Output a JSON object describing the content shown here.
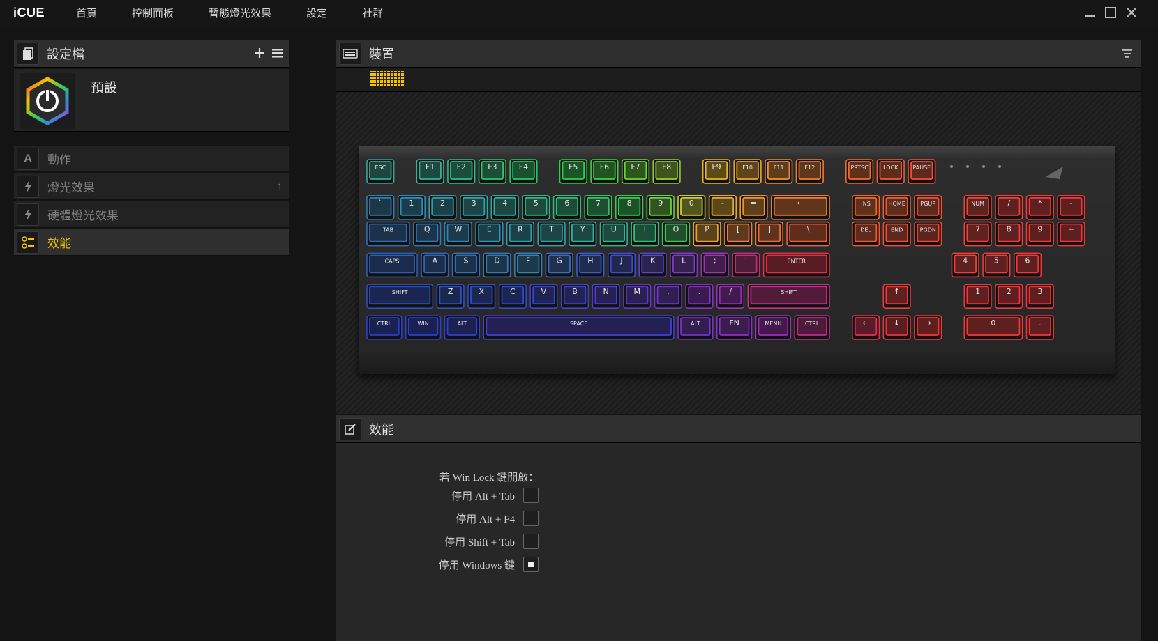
{
  "app": {
    "logo": "iCUE",
    "nav": [
      "首頁",
      "控制面板",
      "暫態燈光效果",
      "設定",
      "社群"
    ],
    "window_controls": [
      "minimize-icon",
      "maximize-icon",
      "close-icon"
    ]
  },
  "profiles": {
    "title": "設定檔",
    "icons": [
      "profiles-icon",
      "add-icon",
      "menu-icon"
    ],
    "current": {
      "name": "預設",
      "icon": "icue-power-logo"
    }
  },
  "menu": [
    {
      "label": "動作",
      "icon": "action-icon",
      "count": "",
      "active": false
    },
    {
      "label": "燈光效果",
      "icon": "lightning-icon",
      "count": "1",
      "active": false
    },
    {
      "label": "硬體燈光效果",
      "icon": "lightning-icon",
      "count": "",
      "active": false
    },
    {
      "label": "效能",
      "icon": "performance-icon",
      "count": "",
      "active": true
    }
  ],
  "device": {
    "title": "裝置",
    "icon": "keyboard-icon",
    "accent": "#f2c200"
  },
  "performance": {
    "title": "效能",
    "icon": "edit-icon",
    "win_lock_title": "若 Win Lock 鍵開啟：",
    "options": [
      {
        "label": "停用 Alt + Tab",
        "checked": false
      },
      {
        "label": "停用 Alt + F4",
        "checked": false
      },
      {
        "label": "停用 Shift + Tab",
        "checked": false
      },
      {
        "label": "停用 Windows 鍵",
        "checked": true
      }
    ]
  },
  "keyboard": {
    "rows": [
      [
        [
          "ESC",
          1,
          "#35a89a"
        ],
        [
          "gap",
          0.6
        ],
        [
          "F1",
          1,
          "#2fb59b"
        ],
        [
          "F2",
          1,
          "#2fbd8b"
        ],
        [
          "F3",
          1,
          "#2bc47a"
        ],
        [
          "F4",
          1,
          "#28c868"
        ],
        [
          "gap",
          0.6
        ],
        [
          "F5",
          1,
          "#2dd04c"
        ],
        [
          "F6",
          1,
          "#3bd43c"
        ],
        [
          "F7",
          1,
          "#68d43a"
        ],
        [
          "F8",
          1,
          "#96d030"
        ],
        [
          "gap",
          0.6
        ],
        [
          "F9",
          1,
          "#e8b820"
        ],
        [
          "F10",
          1,
          "#eda628"
        ],
        [
          "F11",
          1,
          "#ef922c"
        ],
        [
          "F12",
          1,
          "#f07e2e"
        ],
        [
          "gap",
          0.6
        ],
        [
          "PRTSC",
          1,
          "#f06a2e"
        ],
        [
          "LOCK",
          1,
          "#f05e30"
        ],
        [
          "PAUSE",
          1,
          "#f05232"
        ]
      ],
      [
        [
          "`",
          1,
          "#2e7fb0"
        ],
        [
          "1",
          1,
          "#2f8cb5"
        ],
        [
          "2",
          1,
          "#2f99b0"
        ],
        [
          "3",
          1,
          "#30a5a8"
        ],
        [
          "4",
          1,
          "#31ad9e"
        ],
        [
          "5",
          1,
          "#31b48f"
        ],
        [
          "6",
          1,
          "#30bc7d"
        ],
        [
          "7",
          1,
          "#2fc46a"
        ],
        [
          "8",
          1,
          "#34cc52"
        ],
        [
          "9",
          1,
          "#6ed03c"
        ],
        [
          "0",
          1,
          "#c8d030"
        ],
        [
          "-",
          1,
          "#e8ac28"
        ],
        [
          "=",
          1,
          "#ee9430"
        ],
        [
          "←",
          2,
          "#f07a2e"
        ],
        [
          "gap",
          0.6
        ],
        [
          "INS",
          1,
          "#f06a2e"
        ],
        [
          "HOME",
          1,
          "#f05e30"
        ],
        [
          "PGUP",
          1,
          "#f05232"
        ],
        [
          "gap",
          0.6
        ],
        [
          "NUM",
          1,
          "#f04438"
        ],
        [
          "/",
          1,
          "#f04038"
        ],
        [
          "*",
          1,
          "#f03c3a"
        ],
        [
          "-",
          1,
          "#f0383a"
        ]
      ],
      [
        [
          "TAB",
          1.5,
          "#2d6fb4"
        ],
        [
          "Q",
          1,
          "#2d7ab8"
        ],
        [
          "W",
          1,
          "#2e86b8"
        ],
        [
          "E",
          1,
          "#2f92b6"
        ],
        [
          "R",
          1,
          "#2f9cb2"
        ],
        [
          "T",
          1,
          "#30a6aa"
        ],
        [
          "Y",
          1,
          "#31b09e"
        ],
        [
          "U",
          1,
          "#31b690"
        ],
        [
          "I",
          1,
          "#30be7c"
        ],
        [
          "O",
          1,
          "#40c45e"
        ],
        [
          "P",
          1,
          "#e89e2c"
        ],
        [
          "[",
          1,
          "#ef842e"
        ],
        [
          "]",
          1,
          "#f07230"
        ],
        [
          "\\",
          1.5,
          "#f06232"
        ],
        [
          "gap",
          0.6
        ],
        [
          "DEL",
          1,
          "#f05a32"
        ],
        [
          "END",
          1,
          "#f05034"
        ],
        [
          "PGDN",
          1,
          "#f04834"
        ],
        [
          "gap",
          0.6
        ],
        [
          "7",
          1,
          "#f04238"
        ],
        [
          "8",
          1,
          "#f03e3a"
        ],
        [
          "9",
          1,
          "#f03a3a"
        ],
        [
          "+",
          1,
          "#f0363c"
        ]
      ],
      [
        [
          "CAPS",
          1.75,
          "#2d5cb8"
        ],
        [
          "A",
          1,
          "#2d66ba"
        ],
        [
          "S",
          1,
          "#2e70ba"
        ],
        [
          "D",
          1,
          "#2e7ab8"
        ],
        [
          "F",
          1,
          "#2f84b8"
        ],
        [
          "G",
          1,
          "#3a6cc0"
        ],
        [
          "H",
          1,
          "#3a5cc8"
        ],
        [
          "J",
          1,
          "#3e4ccc"
        ],
        [
          "K",
          1,
          "#5a44c8"
        ],
        [
          "L",
          1,
          "#7c3cc4"
        ],
        [
          ";",
          1,
          "#9c34b8"
        ],
        [
          "'",
          1,
          "#c0307a"
        ],
        [
          "ENTER",
          2.25,
          "#e03046"
        ],
        [
          "gap",
          3.8
        ],
        [
          "4",
          1,
          "#f04038"
        ],
        [
          "5",
          1,
          "#f03c3a"
        ],
        [
          "6",
          1,
          "#f0383a"
        ]
      ],
      [
        [
          "SHIFT",
          2.25,
          "#2c4ec2"
        ],
        [
          "Z",
          1,
          "#2c52c4"
        ],
        [
          "X",
          1,
          "#2d4ec8"
        ],
        [
          "C",
          1,
          "#2f4acc"
        ],
        [
          "V",
          1,
          "#3846ce"
        ],
        [
          "B",
          1,
          "#4242ce"
        ],
        [
          "N",
          1,
          "#4c40cc"
        ],
        [
          "M",
          1,
          "#5a3cca"
        ],
        [
          ",",
          1,
          "#6e38c8"
        ],
        [
          ".",
          1,
          "#8232c4"
        ],
        [
          "/",
          1,
          "#9a2ebc"
        ],
        [
          "SHIFT",
          2.75,
          "#c83086"
        ],
        [
          "gap",
          1.6
        ],
        [
          "↑",
          1,
          "#f03c3a"
        ],
        [
          "gap",
          1.6
        ],
        [
          "1",
          1,
          "#f0383a"
        ],
        [
          "2",
          1,
          "#f0363c"
        ],
        [
          "3",
          1,
          "#f0343c"
        ]
      ],
      [
        [
          "CTRL",
          1.25,
          "#2b40c6"
        ],
        [
          "WIN",
          1.25,
          "#2c40ca"
        ],
        [
          "ALT",
          1.25,
          "#3140cc"
        ],
        [
          "SPACE",
          6.25,
          "#4440d0"
        ],
        [
          "ALT",
          1.25,
          "#7434c8"
        ],
        [
          "FN",
          1.25,
          "#8a30c4"
        ],
        [
          "MENU",
          1.25,
          "#a02cb8"
        ],
        [
          "CTRL",
          1.25,
          "#c02c8c"
        ],
        [
          "gap",
          0.6
        ],
        [
          "←",
          1,
          "#e03252"
        ],
        [
          "↓",
          1,
          "#e8343c"
        ],
        [
          "→",
          1,
          "#f03a38"
        ],
        [
          "gap",
          0.6
        ],
        [
          "0",
          2,
          "#f03a3a"
        ],
        [
          ".",
          1,
          "#f0363c"
        ]
      ]
    ]
  }
}
